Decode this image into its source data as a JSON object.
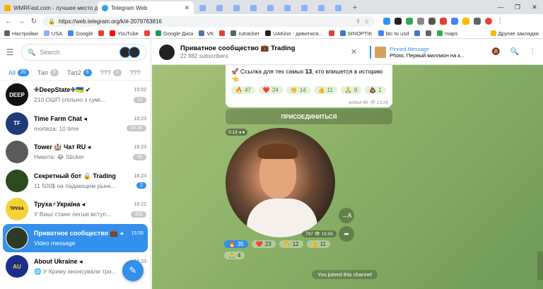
{
  "browser": {
    "tabs": [
      {
        "title": "WMRFast.com - лучшее место для",
        "color": "#f4b400",
        "active": false
      },
      {
        "title": "Telegram Web",
        "color": "#2aa3e0",
        "active": true
      }
    ],
    "url": "https://web.telegram.org/k/#-2079763816",
    "bookmarks": [
      {
        "label": "Настройки",
        "color": "#5f6368"
      },
      {
        "label": "USA",
        "color": "#8ab4f8"
      },
      {
        "label": "Google",
        "color": "#4285f4"
      },
      {
        "label": "",
        "color": "#e34133"
      },
      {
        "label": "YouTube",
        "color": "#ff0000"
      },
      {
        "label": "",
        "color": "#ea4335"
      },
      {
        "label": "Google Диск",
        "color": "#0f9d58"
      },
      {
        "label": "VK",
        "color": "#4a76a8"
      },
      {
        "label": "",
        "color": "#e34133"
      },
      {
        "label": "rutracker",
        "color": "#5f6368"
      },
      {
        "label": "UAKino - дивитися...",
        "color": "#222"
      },
      {
        "label": "",
        "color": "#e34133"
      },
      {
        "label": "SINOPTIK",
        "color": "#3a78c2"
      },
      {
        "label": "btc to usd",
        "color": "#4285f4"
      },
      {
        "label": "",
        "color": "#3a78c2"
      },
      {
        "label": "",
        "color": "#5f6368"
      },
      {
        "label": "maps",
        "color": "#34a853"
      }
    ],
    "other_bookmarks": "Другие закладки"
  },
  "sidebar": {
    "search_placeholder": "Search",
    "folders": [
      {
        "label": "All",
        "count": "20",
        "active": true
      },
      {
        "label": "Тап",
        "count": "8",
        "active": false
      },
      {
        "label": "Тап2",
        "count": "6",
        "active": false
      },
      {
        "label": "???",
        "count": "3",
        "active": false
      },
      {
        "label": "???",
        "count": "",
        "active": false
      }
    ],
    "chats": [
      {
        "name": "✙DeepState✙🇺🇦 ✔",
        "time": "15:02",
        "last": "210 ОШП спільно з сумі...",
        "badge": "12",
        "badge_blue": false,
        "ava_color": "#111111",
        "ava_text": "DEEP"
      },
      {
        "name": "Time Farm Chat ◂",
        "time": "16:23",
        "last": "morteza: 10 time",
        "badge": "19.3K",
        "badge_blue": false,
        "ava_color": "#1f3a7a",
        "ava_text": "TF"
      },
      {
        "name": "Tower 🏰 Чат RU ◂",
        "time": "16:23",
        "last": "Никита: 😂 Sticker",
        "badge": "4K",
        "badge_blue": false,
        "ava_color": "#5a5a5a",
        "ava_text": ""
      },
      {
        "name": "Секретный бот 🔒 Trading",
        "time": "16:23",
        "last": "11 500$ на падающем рынк...",
        "badge": "2",
        "badge_blue": true,
        "ava_color": "#2d4a1e",
        "ava_text": ""
      },
      {
        "name": "Труха⚡Україна ◂",
        "time": "16:22",
        "last": "У Виші стане легше вступ...",
        "badge": "151",
        "badge_blue": false,
        "ava_color": "#f6d23a",
        "ava_text": "ТРУХА"
      },
      {
        "name": "Приватное сообщество 💼 ◂",
        "time": "15:55",
        "last": "Video message",
        "badge": "",
        "badge_blue": false,
        "ava_color": "#2e3b24",
        "ava_text": "",
        "active": true
      },
      {
        "name": "About Ukraine ◂",
        "time": "16:23",
        "last": "🌐 У Криму анонсували три...",
        "badge": "",
        "badge_blue": false,
        "ava_color": "#1a2f8a",
        "ava_text": "AU"
      }
    ]
  },
  "chat": {
    "title": "Приватное сообщество 💼 Trading",
    "subscribers": "22 882 subscribers",
    "pinned_label": "Pinned Message",
    "pinned_text": "Photo, Первый миллион на к...",
    "message_text_pre": "🚀 Ссылка для тех самых ",
    "message_bold": "13",
    "message_text_post": ", кто впишется в историю 👈",
    "reactions": [
      {
        "emoji": "🔥",
        "count": "47",
        "sel": false
      },
      {
        "emoji": "❤️",
        "count": "24",
        "sel": false
      },
      {
        "emoji": "👏",
        "count": "14",
        "sel": false
      },
      {
        "emoji": "👍",
        "count": "11",
        "sel": false
      },
      {
        "emoji": "🙏",
        "count": "6",
        "sel": false
      },
      {
        "emoji": "💩",
        "count": "1",
        "sel": false
      }
    ],
    "message_meta": "edited 4K 👁 13:26",
    "join_label": "ПРИСОЕДИНИТЬСЯ",
    "video_duration": "0:13 ◂ ●",
    "video_meta": "797 👁 15:55",
    "video_reactions": [
      {
        "emoji": "🔥",
        "count": "35",
        "sel": true
      },
      {
        "emoji": "❤️",
        "count": "23",
        "sel": false
      },
      {
        "emoji": "👏",
        "count": "12",
        "sel": false
      },
      {
        "emoji": "👍",
        "count": "11",
        "sel": false
      },
      {
        "emoji": "🙏",
        "count": "4",
        "sel": false
      }
    ],
    "service_message": "You joined this channel"
  }
}
